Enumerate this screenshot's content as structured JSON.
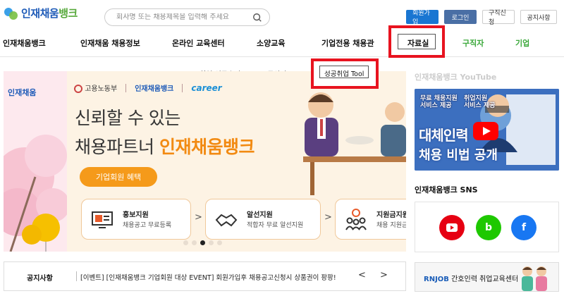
{
  "brand": {
    "name_main": "인재채움",
    "name_accent": "뱅크"
  },
  "search": {
    "placeholder": "회사명 또는 채용제목을 입력해 주세요"
  },
  "top_links": [
    "회원가입",
    "로그인",
    "구직신청",
    "공지사항"
  ],
  "nav": {
    "items": [
      "인재채움뱅크",
      "인재채움 채용정보",
      "온라인 교육센터",
      "소양교육",
      "기업전용 채용관",
      "자료실",
      "구직자",
      "기업"
    ]
  },
  "subnav": [
    "취업 성공수기",
    "노무상담 FAQ",
    "성공취업 Tool"
  ],
  "banner": {
    "logos": [
      "고용노동부",
      "인재채움뱅크",
      "career"
    ],
    "headline_line1": "신뢰할 수 있는",
    "headline_line2_prefix": "채용파트너 ",
    "headline_line2_accent": "인재채움뱅크",
    "cta": "기업회원 혜택",
    "cards": [
      {
        "title": "홍보지원",
        "subtitle": "채용공고 무료등록"
      },
      {
        "title": "알선지원",
        "subtitle": "적합자 무료 알선지원"
      },
      {
        "title": "지원금지원",
        "subtitle": "채용 지원금"
      }
    ],
    "dots": 5,
    "active_dot": 2
  },
  "notice": {
    "label": "공지사항",
    "text": "[이벤트] [인재채움뱅크 기업회원 대상 EVENT] 회원가입후 채용공고신청시 상품권이 팡팡!",
    "prev": "<",
    "next": ">"
  },
  "youtube": {
    "title": "인재채움뱅크 YouTube",
    "thumb_badge1": "무료 채용지원\n서비스 제공",
    "thumb_badge2": "취업지원\n서비스 제공",
    "thumb_line1": "대체인력",
    "thumb_line2": "채용 비법 공개"
  },
  "sns": {
    "title": "인재채움뱅크 SNS",
    "buttons": [
      "youtube",
      "blog",
      "facebook"
    ]
  },
  "rnjob": {
    "brand": "RNJOB",
    "text": " 간호인력 취업교육센터"
  }
}
